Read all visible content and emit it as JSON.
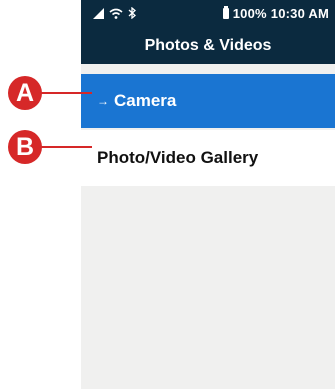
{
  "status_bar": {
    "battery": "100%",
    "time": "10:30 AM",
    "icons": [
      "signal-icon",
      "wifi-icon",
      "bluetooth-icon",
      "battery-icon"
    ]
  },
  "header": {
    "title": "Photos & Videos"
  },
  "menu": {
    "items": [
      {
        "label": "Camera",
        "selected": true,
        "indicator": "→"
      },
      {
        "label": "Photo/Video Gallery",
        "selected": false
      }
    ]
  },
  "callouts": [
    {
      "label": "A"
    },
    {
      "label": "B"
    }
  ],
  "colors": {
    "header_bg": "#0b2a3f",
    "selected_bg": "#1a75d2",
    "callout": "#d62828",
    "screen_bg": "#f0f0ef"
  }
}
